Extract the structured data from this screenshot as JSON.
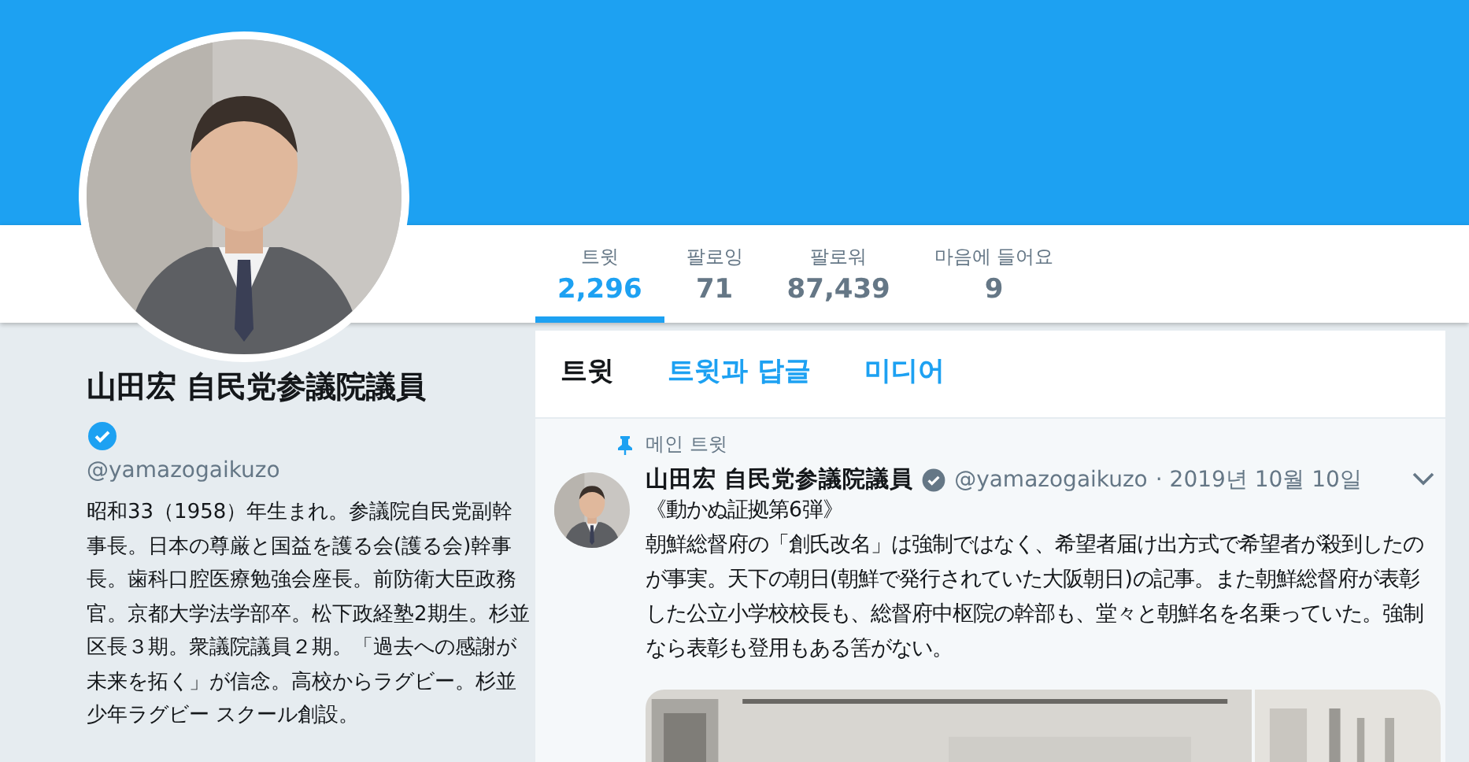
{
  "profile": {
    "name": "山田宏 自民党参議院議員",
    "verified": true,
    "handle": "@yamazogaikuzo",
    "bio": "昭和33（1958）年生まれ。参議院自民党副幹事長。日本の尊厳と国益を護る会(護る会)幹事長。歯科口腔医療勉強会座長。前防衛大臣政務官。京都大学法学部卒。松下政経塾2期生。杉並区長３期。衆議院議員２期。「過去への感謝が未来を拓く」が信念。高校からラグビー。杉並少年ラグビー スクール創設。"
  },
  "stats": [
    {
      "label": "트윗",
      "value": "2,296",
      "selected": true
    },
    {
      "label": "팔로잉",
      "value": "71",
      "selected": false
    },
    {
      "label": "팔로워",
      "value": "87,439",
      "selected": false
    },
    {
      "label": "마음에 들어요",
      "value": "9",
      "selected": false
    }
  ],
  "tabs": [
    {
      "label": "트윗",
      "selected": true
    },
    {
      "label": "트윗과 답글",
      "selected": false
    },
    {
      "label": "미디어",
      "selected": false
    }
  ],
  "tweet": {
    "pinned_label": "메인 트윗",
    "name": "山田宏 自民党参議院議員",
    "verified": true,
    "handle": "@yamazogaikuzo",
    "date": "· 2019년 10월 10일",
    "title": "《動かぬ証拠第6弾》",
    "text": "朝鮮総督府の「創氏改名」は強制ではなく、希望者届け出方式で希望者が殺到したのが事実。天下の朝日(朝鮮で発行されていた大阪朝日)の記事。また朝鮮総督府が表彰した公立小学校校長も、総督府中枢院の幹部も、堂々と朝鮮名を名乗っていた。強制なら表彰も登用もある筈がない。"
  }
}
